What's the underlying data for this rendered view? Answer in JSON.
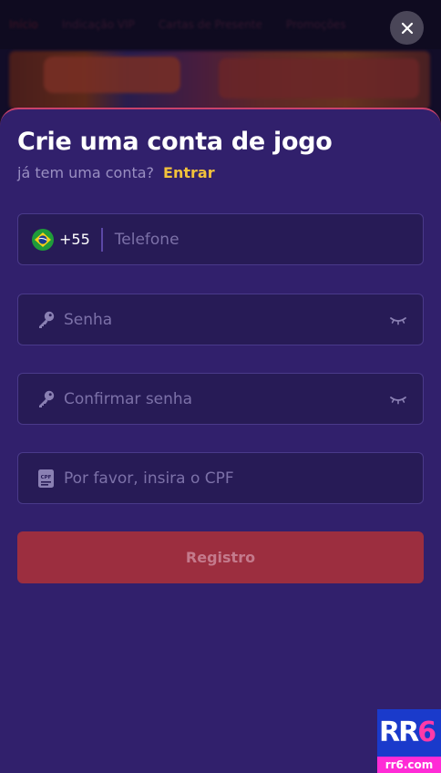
{
  "background": {
    "nav_items": [
      "Início",
      "Indicação VIP",
      "Cartas de Presente",
      "Promoções"
    ]
  },
  "modal": {
    "title": "Crie uma conta de jogo",
    "subtitle": "já tem uma conta?",
    "login_link": "Entrar",
    "phone": {
      "dial_code": "+55",
      "placeholder": "Telefone",
      "flag_icon": "brazil-flag-icon"
    },
    "password": {
      "placeholder": "Senha",
      "icon": "key-icon"
    },
    "confirm_password": {
      "placeholder": "Confirmar senha",
      "icon": "key-icon"
    },
    "cpf": {
      "placeholder": "Por favor, insira o CPF",
      "icon": "cpf-card-icon",
      "icon_text": "CPF"
    },
    "submit_label": "Registro"
  },
  "watermark": {
    "brand": "RR",
    "brand_digit": "6",
    "domain": "rr6.com"
  },
  "colors": {
    "sheet": "#31206c",
    "field_bg": "#271b56",
    "accent_link": "#f2c13b",
    "submit": "#9c2e3f"
  }
}
